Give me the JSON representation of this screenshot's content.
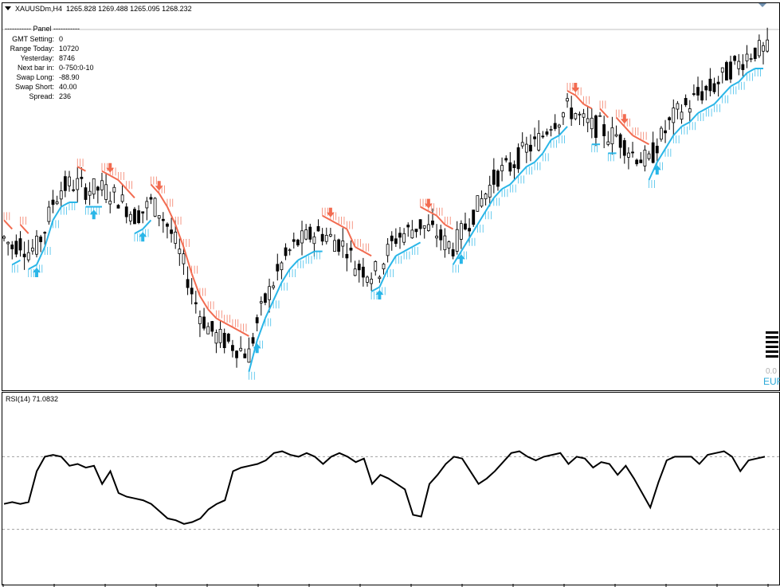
{
  "chart_window": {
    "symbol": "XAUUSDm,H4",
    "ohlc": "1265.828 1269.488 1265.095 1268.232",
    "rsi_label": "RSI(14) 71.0832"
  },
  "panel": {
    "header": "----------- Panel -----------",
    "rows": [
      {
        "label": "GMT Setting:",
        "value": "0"
      },
      {
        "label": "Range Today:",
        "value": "10720"
      },
      {
        "label": "Yesterday:",
        "value": "8746"
      },
      {
        "label": "Next bar in:",
        "value": "0-750:0-10"
      },
      {
        "label": "Swap Long:",
        "value": "-88.90"
      },
      {
        "label": "Swap Short:",
        "value": "40.00"
      },
      {
        "label": "Spread:",
        "value": "236"
      }
    ]
  },
  "corner_widget": {
    "number": "0.0",
    "currency": "EUR"
  },
  "colors": {
    "uptrend": "#29b6e8",
    "downtrend": "#f26b50",
    "candle": "#000000"
  },
  "rsi": {
    "levels": [
      70,
      30
    ]
  },
  "chart_data": [
    {
      "type": "line",
      "title": "XAUUSDm,H4",
      "series": [
        {
          "name": "",
          "values": [
            1264,
            1262,
            1263,
            1261,
            1262,
            1266,
            1272,
            1275,
            1276,
            1276,
            1275,
            1275,
            1275,
            1274,
            1273,
            1271,
            1269,
            1270,
            1272,
            1270,
            1267,
            1263,
            1258,
            1252,
            1247,
            1244,
            1242,
            1241,
            1240,
            1239,
            1238,
            1245,
            1250,
            1254,
            1258,
            1261,
            1263,
            1264,
            1265,
            1265,
            1264,
            1263,
            1262,
            1258,
            1257,
            1256,
            1257,
            1261,
            1264,
            1265,
            1266,
            1267,
            1266,
            1265,
            1263,
            1262,
            1265,
            1268,
            1271,
            1274,
            1277,
            1279,
            1280,
            1282,
            1284,
            1285,
            1287,
            1290,
            1291,
            1293,
            1292,
            1290,
            1289,
            1289,
            1287,
            1287,
            1285,
            1283,
            1282,
            1281,
            1285,
            1288,
            1291,
            1293,
            1294,
            1296,
            1297,
            1298,
            1300,
            1302,
            1303,
            1305,
            1306,
            1306
          ]
        }
      ]
    },
    {
      "type": "line",
      "title": "RSI(14) 71.0832",
      "ylim": [
        0,
        100
      ],
      "series": [
        {
          "name": "RSI(14)",
          "values": [
            44,
            45,
            44,
            45,
            62,
            70,
            71,
            70,
            65,
            66,
            64,
            65,
            55,
            62,
            50,
            48,
            47,
            46,
            44,
            40,
            36,
            35,
            33,
            34,
            36,
            41,
            44,
            46,
            62,
            64,
            65,
            66,
            68,
            72,
            73,
            71,
            70,
            72,
            70,
            66,
            70,
            72,
            70,
            67,
            69,
            55,
            60,
            58,
            55,
            52,
            38,
            37,
            55,
            60,
            66,
            70,
            69,
            62,
            55,
            58,
            62,
            67,
            72,
            73,
            70,
            68,
            70,
            71,
            72,
            66,
            70,
            69,
            64,
            67,
            66,
            60,
            65,
            58,
            50,
            42,
            56,
            68,
            70,
            70,
            70,
            66,
            71,
            72,
            73,
            70,
            62,
            68,
            69,
            70
          ]
        }
      ]
    }
  ]
}
